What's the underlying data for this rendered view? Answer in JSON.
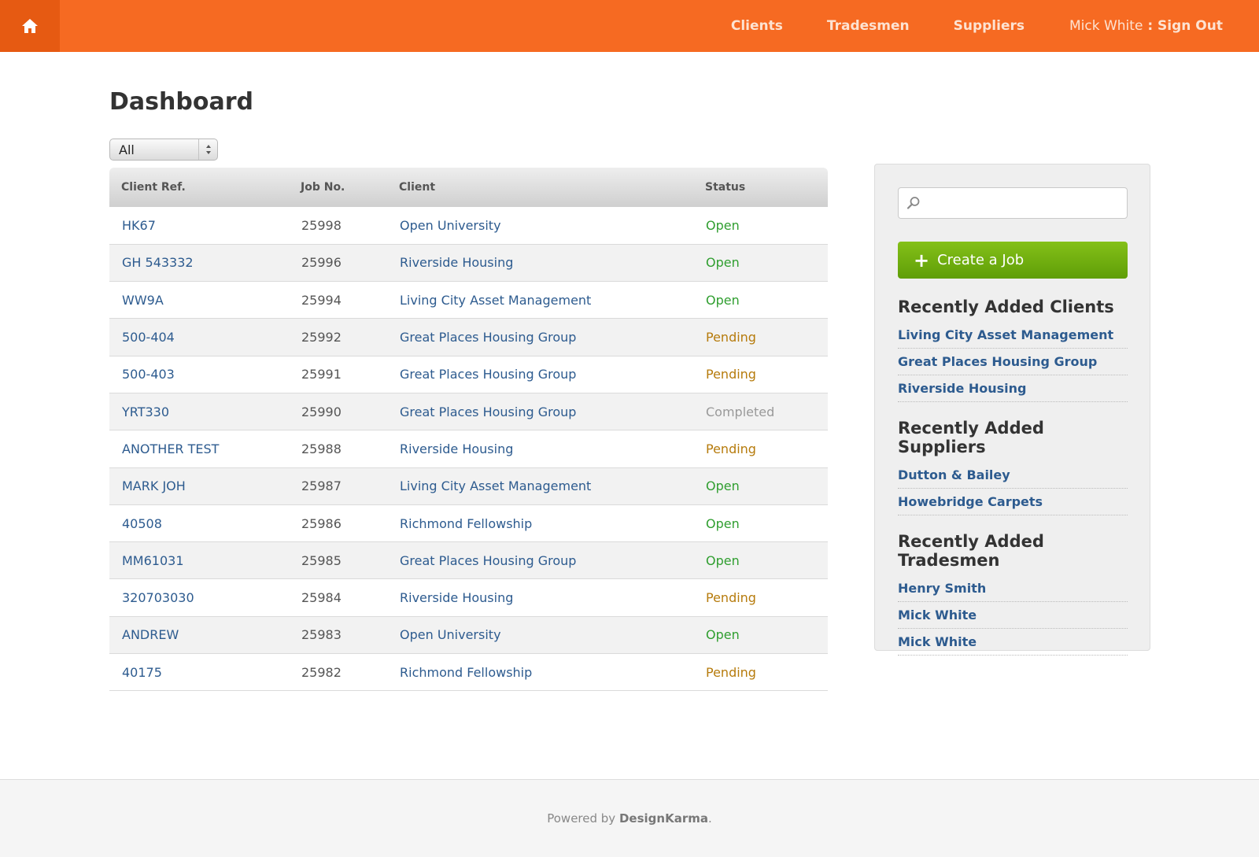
{
  "nav": {
    "home_icon": "home-icon",
    "clients": "Clients",
    "tradesmen": "Tradesmen",
    "suppliers": "Suppliers",
    "user_name": "Mick White",
    "separator": " : ",
    "sign_out": "Sign Out"
  },
  "page": {
    "title": "Dashboard"
  },
  "filter": {
    "selected": "All"
  },
  "table": {
    "headers": [
      "Client Ref.",
      "Job No.",
      "Client",
      "Status"
    ],
    "rows": [
      {
        "ref": "HK67",
        "job": "25998",
        "client": "Open University",
        "status": "Open"
      },
      {
        "ref": "GH 543332",
        "job": "25996",
        "client": "Riverside Housing",
        "status": "Open"
      },
      {
        "ref": "WW9A",
        "job": "25994",
        "client": "Living City Asset Management",
        "status": "Open"
      },
      {
        "ref": "500-404",
        "job": "25992",
        "client": "Great Places Housing Group",
        "status": "Pending"
      },
      {
        "ref": "500-403",
        "job": "25991",
        "client": "Great Places Housing Group",
        "status": "Pending"
      },
      {
        "ref": "YRT330",
        "job": "25990",
        "client": "Great Places Housing Group",
        "status": "Completed"
      },
      {
        "ref": "ANOTHER TEST",
        "job": "25988",
        "client": "Riverside Housing",
        "status": "Pending"
      },
      {
        "ref": "MARK JOH",
        "job": "25987",
        "client": "Living City Asset Management",
        "status": "Open"
      },
      {
        "ref": "40508",
        "job": "25986",
        "client": "Richmond Fellowship",
        "status": "Open"
      },
      {
        "ref": "MM61031",
        "job": "25985",
        "client": "Great Places Housing Group",
        "status": "Open"
      },
      {
        "ref": "320703030",
        "job": "25984",
        "client": "Riverside Housing",
        "status": "Pending"
      },
      {
        "ref": "ANDREW",
        "job": "25983",
        "client": "Open University",
        "status": "Open"
      },
      {
        "ref": "40175",
        "job": "25982",
        "client": "Richmond Fellowship",
        "status": "Pending"
      }
    ]
  },
  "sidebar": {
    "search": {
      "placeholder": "",
      "icon": "search-icon"
    },
    "create_job": "Create a Job",
    "clients_heading": "Recently Added Clients",
    "clients": [
      "Living City Asset Management",
      "Great Places Housing Group",
      "Riverside Housing"
    ],
    "suppliers_heading": "Recently Added Suppliers",
    "suppliers": [
      "Dutton & Bailey",
      "Howebridge Carpets"
    ],
    "tradesmen_heading": "Recently Added Tradesmen",
    "tradesmen": [
      "Henry Smith",
      "Mick White",
      "Mick White"
    ]
  },
  "footer": {
    "prefix": "Powered by ",
    "brand": "DesignKarma",
    "suffix": "."
  },
  "colors": {
    "topbar": "#f66a22",
    "link": "#2d5b8f",
    "status_open": "#2f9e2f",
    "status_pending": "#b67b0c",
    "status_completed": "#999999",
    "create_button": "#6fae0f"
  }
}
